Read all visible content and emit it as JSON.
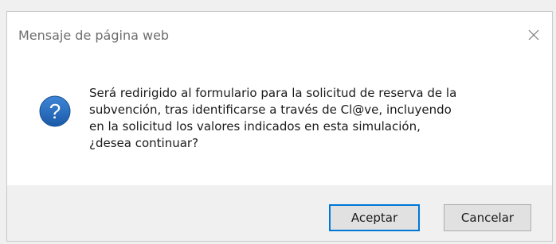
{
  "dialog": {
    "title": "Mensaje de página web",
    "message_lines": [
      "Será redirigido al formulario para la solicitud de reserva de la",
      "subvención, tras identificarse a través de Cl@ve, incluyendo",
      "en la solicitud los valores indicados en esta simulación,",
      "¿desea continuar?"
    ],
    "icon": "question-icon",
    "close_icon": "close-icon",
    "ok_label": "Aceptar",
    "cancel_label": "Cancelar"
  },
  "colors": {
    "icon_blue": "#1c63b7",
    "default_button_border": "#0078d7",
    "footer_bg": "#f0f0f0"
  }
}
